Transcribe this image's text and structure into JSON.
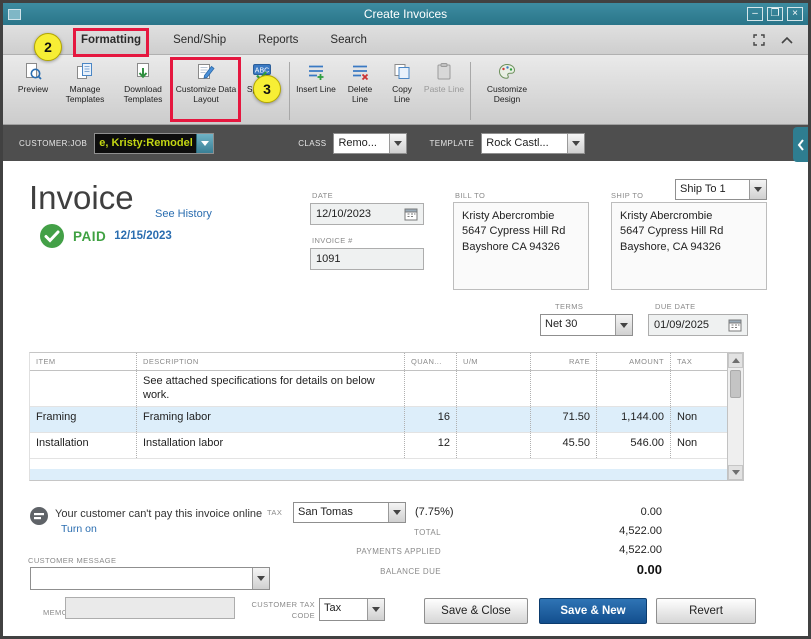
{
  "window": {
    "title": "Create Invoices",
    "controls": {
      "minimize": "–",
      "maximize": "❐",
      "close": "×"
    }
  },
  "callouts": {
    "step2": "2",
    "step3": "3"
  },
  "menu": {
    "tabs": [
      {
        "label": "Formatting"
      },
      {
        "label": "Send/Ship"
      },
      {
        "label": "Reports"
      },
      {
        "label": "Search"
      }
    ]
  },
  "toolbar": {
    "buttons": [
      {
        "label": "Preview"
      },
      {
        "label": "Manage Templates"
      },
      {
        "label": "Download Templates"
      },
      {
        "label": "Customize Data Layout"
      },
      {
        "label": "Spelling"
      },
      {
        "label": "Insert Line"
      },
      {
        "label": "Delete Line"
      },
      {
        "label": "Copy Line"
      },
      {
        "label": "Paste Line"
      },
      {
        "label": "Customize Design"
      }
    ]
  },
  "customer_bar": {
    "customer_label": "CUSTOMER:JOB",
    "customer_value": "e, Kristy:Remodel",
    "class_label": "CLASS",
    "class_value": "Remo...",
    "template_label": "TEMPLATE",
    "template_value": "Rock Castl..."
  },
  "invoice": {
    "title": "Invoice",
    "see_history_link": "See History",
    "paid_label": "PAID",
    "paid_date": "12/15/2023",
    "date_label": "DATE",
    "date_value": "12/10/2023",
    "number_label": "INVOICE #",
    "number_value": "1091",
    "bill_to_label": "BILL TO",
    "bill_to_line1": "Kristy Abercrombie",
    "bill_to_line2": "5647 Cypress Hill Rd",
    "bill_to_line3": "Bayshore CA 94326",
    "ship_to_label": "SHIP TO",
    "ship_to_selected": "Ship To 1",
    "ship_to_line1": "Kristy Abercrombie",
    "ship_to_line2": "5647 Cypress Hill Rd",
    "ship_to_line3": "Bayshore, CA 94326",
    "terms_label": "TERMS",
    "terms_value": "Net 30",
    "due_date_label": "DUE DATE",
    "due_date_value": "01/09/2025"
  },
  "items_table": {
    "headers": {
      "item": "ITEM",
      "description": "DESCRIPTION",
      "quantity": "QUAN...",
      "um": "U/M",
      "rate": "RATE",
      "amount": "AMOUNT",
      "tax": "TAX"
    },
    "rows": [
      {
        "item": "",
        "description": "See attached specifications for details on below work.",
        "quantity": "",
        "um": "",
        "rate": "",
        "amount": "",
        "tax": ""
      },
      {
        "item": "Framing",
        "description": "Framing labor",
        "quantity": "16",
        "um": "",
        "rate": "71.50",
        "amount": "1,144.00",
        "tax": "Non"
      },
      {
        "item": "Installation",
        "description": "Installation labor",
        "quantity": "12",
        "um": "",
        "rate": "45.50",
        "amount": "546.00",
        "tax": "Non"
      }
    ]
  },
  "footer": {
    "online_payment_text": "Your customer can't pay this invoice online",
    "turn_on_link": "Turn on",
    "tax_label": "TAX",
    "tax_value": "San Tomas",
    "tax_rate": "(7.75%)",
    "tax_amount": "0.00",
    "total_label": "TOTAL",
    "total_value": "4,522.00",
    "payments_label": "PAYMENTS APPLIED",
    "payments_value": "4,522.00",
    "balance_label": "BALANCE DUE",
    "balance_value": "0.00",
    "customer_message_label": "CUSTOMER MESSAGE",
    "memo_label": "MEMO",
    "customer_tax_code_label": "CUSTOMER TAX CODE",
    "customer_tax_code_value": "Tax",
    "save_close_button": "Save & Close",
    "save_new_button": "Save & New",
    "revert_button": "Revert"
  },
  "icons": {
    "spelling_abc": "ABC"
  },
  "colors": {
    "titlebar_teal": "#2e7f92",
    "annotation_red": "#e5173f",
    "callout_yellow": "#f7ee35",
    "paid_green": "#3fa142",
    "link_blue": "#2a6db0",
    "primary_button_blue": "#15569b",
    "row_highlight_blue": "#ddeefa",
    "customer_highlight_text": "#c3d613"
  }
}
